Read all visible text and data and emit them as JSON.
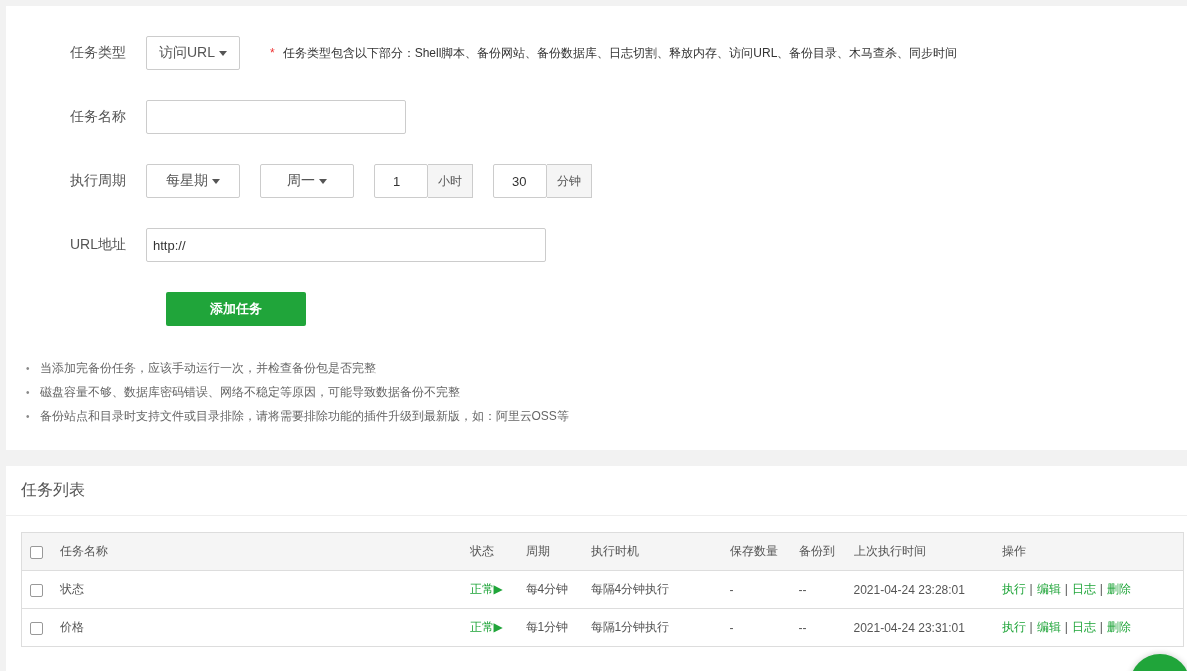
{
  "task_type": {
    "label": "任务类型",
    "value": "访问URL",
    "required_mark": "*",
    "note": "任务类型包含以下部分：Shell脚本、备份网站、备份数据库、日志切割、释放内存、访问URL、备份目录、木马查杀、同步时间"
  },
  "task_name": {
    "label": "任务名称"
  },
  "period": {
    "label": "执行周期",
    "selects": [
      "每星期",
      "周一"
    ],
    "hour": {
      "value": "1",
      "unit": "小时"
    },
    "minute": {
      "value": "30",
      "unit": "分钟"
    }
  },
  "url": {
    "label": "URL地址",
    "value": "http://"
  },
  "submit_button": "添加任务",
  "note_bullet": "•",
  "notes": [
    "当添加完备份任务，应该手动运行一次，并检查备份包是否完整",
    "磁盘容量不够、数据库密码错误、网络不稳定等原因，可能导致数据备份不完整",
    "备份站点和目录时支持文件或目录排除，请将需要排除功能的插件升级到最新版，如：阿里云OSS等"
  ],
  "task_list": {
    "title": "任务列表",
    "header_checked": false,
    "columns": [
      "任务名称",
      "状态",
      "周期",
      "执行时机",
      "保存数量",
      "备份到",
      "上次执行时间",
      "操作"
    ],
    "action_separator": "|",
    "rows": [
      {
        "checked": false,
        "cells": [
          "状态",
          "正常▶",
          "每4分钟",
          "每隔4分钟执行",
          "-",
          "--",
          "2021-04-24 23:28:01"
        ],
        "actions": [
          "执行",
          "编辑",
          "日志",
          "删除"
        ]
      },
      {
        "checked": false,
        "cells": [
          "价格",
          "正常▶",
          "每1分钟",
          "每隔1分钟执行",
          "-",
          "--",
          "2021-04-24 23:31:01"
        ],
        "actions": [
          "执行",
          "编辑",
          "日志",
          "删除"
        ]
      }
    ]
  }
}
